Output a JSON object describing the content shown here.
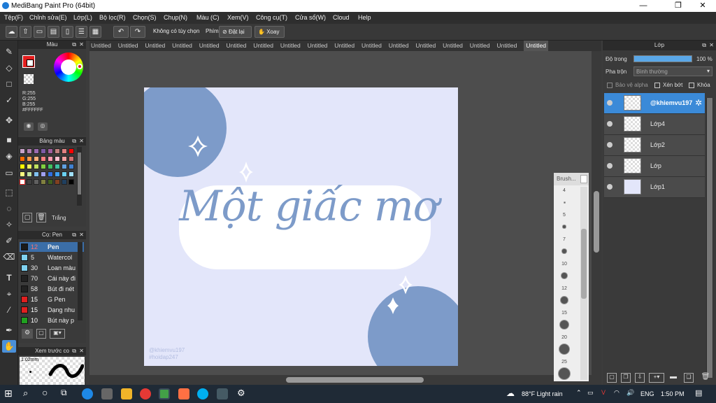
{
  "window": {
    "title": "MediBang Paint Pro (64bit)",
    "minimize": "—",
    "maximize": "❐",
    "close": "✕"
  },
  "menu": [
    "Tệp(F)",
    "Chỉnh sửa(E)",
    "Lớp(L)",
    "Bộ lọc(R)",
    "Chọn(S)",
    "Chụp(N)",
    "Màu (C)",
    "Xem(V)",
    "Công cụ(T)",
    "Cửa sổ(W)",
    "Cloud",
    "Help"
  ],
  "toolbar": {
    "no_options": "Không có tùy chọn",
    "key_label": "Phím",
    "reset": "Đặt lại",
    "rotate": "Xoay"
  },
  "tabs": [
    "Untitled",
    "Untitled",
    "Untitled",
    "Untitled",
    "Untitled",
    "Untitled",
    "Untitled",
    "Untitled",
    "Untitled",
    "Untitled",
    "Untitled",
    "Untitled",
    "Untitled",
    "Untitled",
    "Untitled",
    "Untitled",
    "Untitled"
  ],
  "color_panel": {
    "title": "Màu",
    "r": "R:255",
    "g": "G:255",
    "b": "B:255",
    "hex": "#FFFFFF"
  },
  "palette_panel": {
    "title": "Bảng màu",
    "selected_name": "Trắng",
    "swatches": [
      "#c8a2c8",
      "#b07eb0",
      "#9a6ab0",
      "#7d5ba6",
      "#a05fa0",
      "#c08080",
      "#e08080",
      "#ff0000",
      "#ff6a00",
      "#ff9a4a",
      "#ffb07a",
      "#ff8080",
      "#ff9ab0",
      "#ffc0d0",
      "#f0a0a0",
      "#d07070",
      "#ffff00",
      "#f0f060",
      "#c0e060",
      "#80d040",
      "#40c060",
      "#40c0a0",
      "#60a0e0",
      "#4080d0",
      "#ffff80",
      "#c0e0a0",
      "#80c0f0",
      "#a0a0f0",
      "#3070e0",
      "#40a0f0",
      "#6ad0f0",
      "#a0e0ff",
      "#ffffff",
      "#404040",
      "#606060",
      "#808040",
      "#406020",
      "#804020",
      "#204060",
      "#000000"
    ]
  },
  "brush_panel": {
    "title": "Cọ: Pen",
    "brushes": [
      {
        "size": "12",
        "name": "Pen",
        "color": "#1a1a1a",
        "sel": true
      },
      {
        "size": "5",
        "name": "Watercol",
        "color": "#7fd1f0"
      },
      {
        "size": "30",
        "name": "Loan màu",
        "color": "#7fd1f0"
      },
      {
        "size": "70",
        "name": "Cái này đi",
        "color": "#222222"
      },
      {
        "size": "58",
        "name": "Bút đi nét",
        "color": "#222222"
      },
      {
        "size": "15",
        "name": "G Pen",
        "color": "#e02020"
      },
      {
        "size": "15",
        "name": "Dạng nhu",
        "color": "#e02020"
      },
      {
        "size": "10",
        "name": "Bút này p",
        "color": "#20a020"
      }
    ]
  },
  "preview_panel": {
    "title": "Xem trước co",
    "size": "1.02mm"
  },
  "layer_panel": {
    "title": "Lớp",
    "opacity_label": "Độ trong",
    "opacity_value": "100 %",
    "opacity": 1.0,
    "blend_label": "Pha trộn",
    "blend_value": "Bình thường",
    "protect_alpha": "Bảo vệ alpha",
    "clipping": "Xén bớt",
    "lock": "Khóa",
    "layers": [
      {
        "name": "@khiemvu197",
        "sel": true
      },
      {
        "name": "Lớp4"
      },
      {
        "name": "Lớp2"
      },
      {
        "name": "Lớp"
      },
      {
        "name": "Lớp1"
      }
    ]
  },
  "brush_sizes": {
    "title": "Brush...",
    "sizes": [
      "4",
      "5",
      "7",
      "10",
      "12",
      "15",
      "20",
      "25"
    ]
  },
  "artwork": {
    "text": "Một giấc mơ",
    "watermark1": "@khiemvu197",
    "watermark2": "#hoidap247"
  },
  "taskbar": {
    "weather": "88°F  Light rain",
    "lang": "ENG",
    "time": "1:50 PM"
  }
}
